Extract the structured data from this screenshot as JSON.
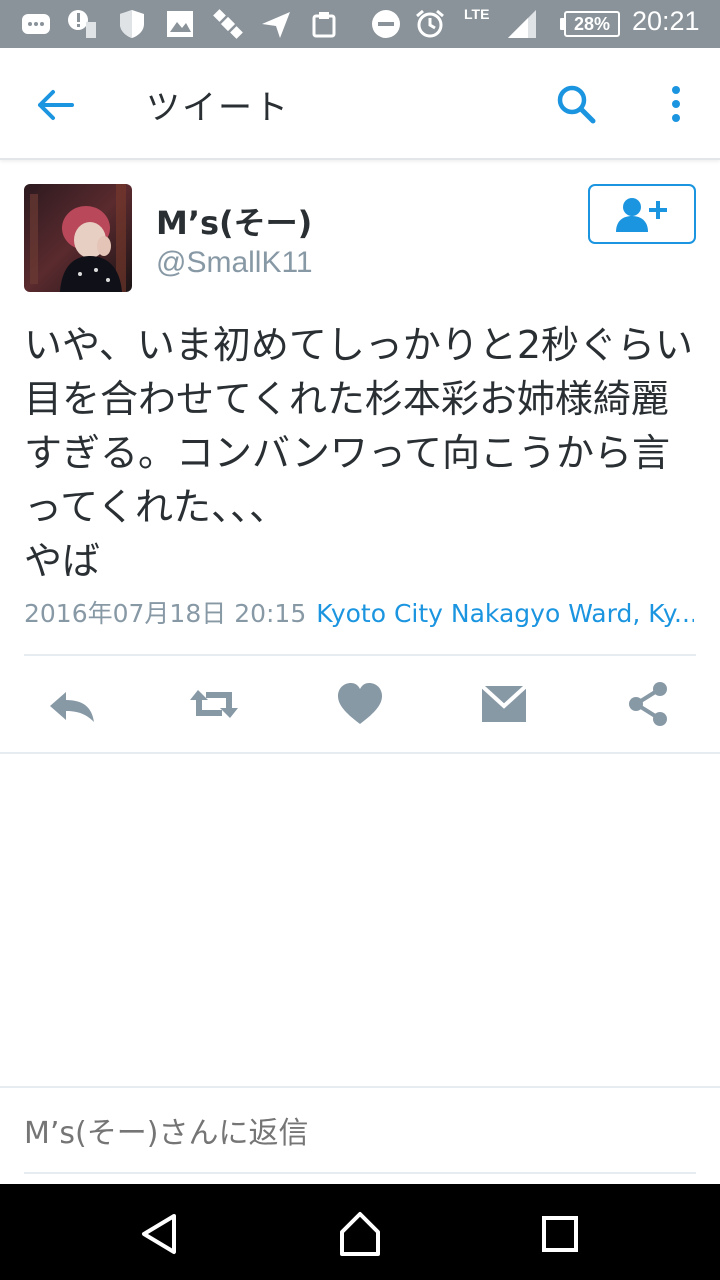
{
  "status_bar": {
    "network": "LTE",
    "battery": "28%",
    "time": "20:21"
  },
  "app_bar": {
    "title": "ツイート"
  },
  "tweet": {
    "author_name": "M’s(そー)",
    "handle": "@SmallK11",
    "text": "いや、いま初めてしっかりと2秒ぐらい目を合わせてくれた杉本彩お姉様綺麗すぎる。コンバンワって向こうから言ってくれた、、、\nやば",
    "timestamp": "2016年07月18日 20:15",
    "location": "Kyoto City Nakagyo Ward, Ky..."
  },
  "reply": {
    "placeholder": "M’s(そー)さんに返信"
  },
  "colors": {
    "accent": "#1b95e0",
    "icon_gray": "#8899a6",
    "text": "#292f33",
    "status_bar": "#8a939a"
  },
  "icons": {
    "back": "arrow-left-icon",
    "search": "search-icon",
    "more": "more-vertical-icon",
    "follow": "add-user-icon",
    "reply": "reply-icon",
    "retweet": "retweet-icon",
    "like": "heart-icon",
    "dm": "envelope-icon",
    "share": "share-icon"
  }
}
